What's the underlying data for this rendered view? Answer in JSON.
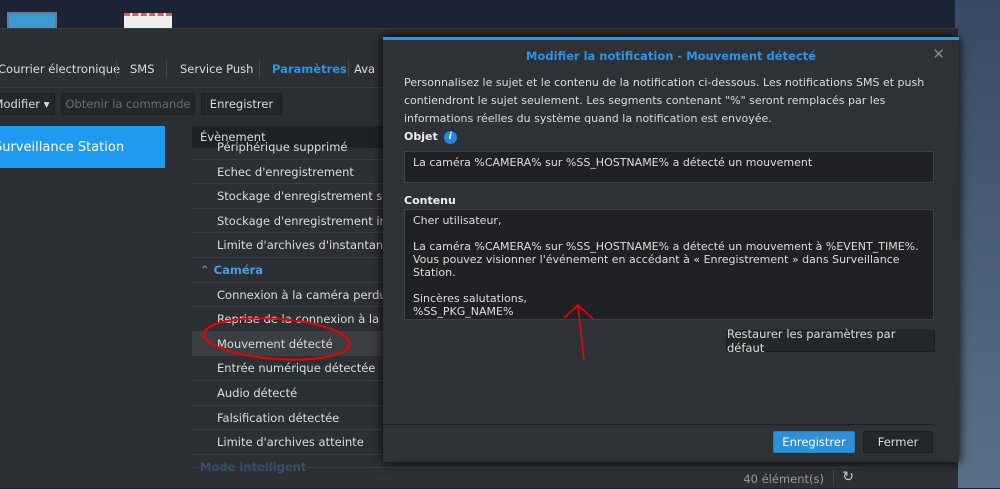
{
  "tabs": [
    {
      "label": "Courrier électronique"
    },
    {
      "label": "SMS"
    },
    {
      "label": "Service Push"
    },
    {
      "label": "Paramètres"
    },
    {
      "label": "Ava"
    }
  ],
  "toolbar": {
    "modify": "Modifier",
    "get_command": "Obtenir la commande",
    "save": "Enregistrer"
  },
  "sidebar": {
    "selected": "Surveillance Station"
  },
  "list": {
    "header": "Évènement",
    "rows": [
      {
        "label": "Périphérique supprimé"
      },
      {
        "label": "Echec d'enregistrement"
      },
      {
        "label": "Stockage d'enregistrement supprimé"
      },
      {
        "label": "Stockage d'enregistrement installé"
      },
      {
        "label": "Limite d'archives d'instantané atteinte"
      },
      {
        "label": "Caméra"
      },
      {
        "label": "Connexion à la caméra perdue"
      },
      {
        "label": "Reprise de la connexion à la caméra"
      },
      {
        "label": "Mouvement détecté"
      },
      {
        "label": "Entrée numérique détectée"
      },
      {
        "label": "Audio détecté"
      },
      {
        "label": "Falsification détectée"
      },
      {
        "label": "Limite d'archives atteinte"
      },
      {
        "label": "Mode intelligent"
      }
    ],
    "count": "40 élément(s)"
  },
  "dialog": {
    "title": "Modifier la notification - Mouvement détecté",
    "description": "Personnalisez le sujet et le contenu de la notification ci-dessous. Les notifications SMS et push contiendront le sujet seulement. Les segments contenant \"%\" seront remplacés par les informations réelles du système quand la notification est envoyée.",
    "subject_label": "Objet",
    "subject": "La caméra %CAMERA% sur %SS_HOSTNAME% a détecté un mouvement",
    "content_label": "Contenu",
    "content": "Cher utilisateur,\n\nLa caméra %CAMERA% sur %SS_HOSTNAME% a détecté un mouvement à %EVENT_TIME%. Vous pouvez visionner l'événement en accédant à « Enregistrement » dans Surveillance Station.\n\nSincères salutations,\n%SS_PKG_NAME%",
    "restore": "Restaurer les paramètres par défaut",
    "save": "Enregistrer",
    "close": "Fermer"
  },
  "colors": {
    "accent": "#1e9bf0",
    "annotation": "#e00000"
  }
}
